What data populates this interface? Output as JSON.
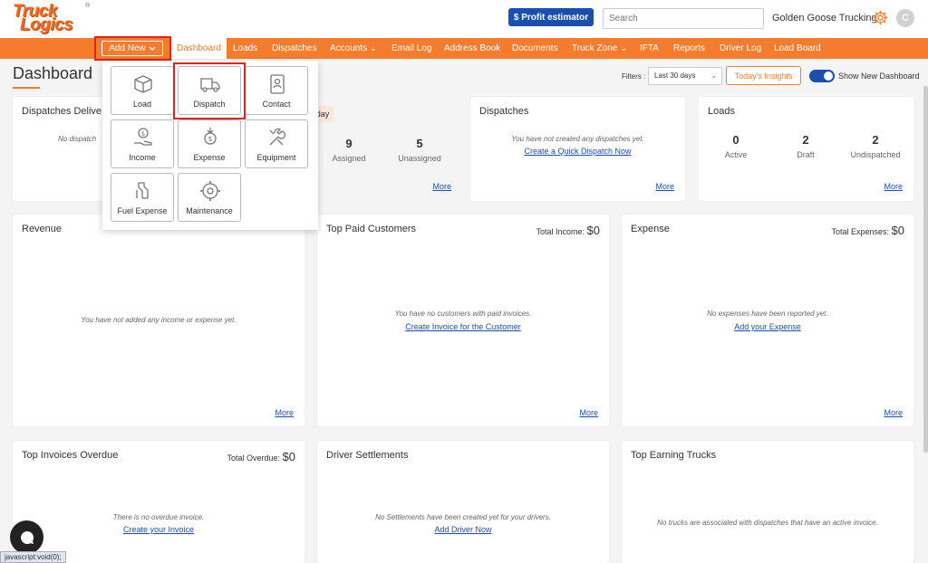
{
  "app": {
    "logo_line1": "Truck",
    "logo_line2": "Logics",
    "logo_reg": "®",
    "profit_estimator": "$ Profit estimator",
    "search_placeholder": "Search",
    "company": "Golden Goose Trucking",
    "avatar_initial": "C"
  },
  "nav": {
    "add_new": "Add New",
    "items": [
      "Dashboard",
      "Loads",
      "Dispatches",
      "Accounts ⌄",
      "Email Log",
      "Address Book",
      "Documents",
      "Truck Zone ⌄",
      "IFTA",
      "Reports",
      "Driver Log",
      "Load Board"
    ]
  },
  "header": {
    "title": "Dashboard",
    "filters_label": "Filters :",
    "filter_value": "Last 30 days",
    "insights": "Today's Insights",
    "toggle_label": "Show New Dashboard"
  },
  "add_menu": {
    "tiles": [
      "Load",
      "Dispatch",
      "Contact",
      "Income",
      "Expense",
      "Equipment",
      "Fuel Expense",
      "Maintenance"
    ]
  },
  "cards": {
    "dispatches_delivered": {
      "title": "Dispatches Delive",
      "empty": "No dispatch"
    },
    "day_tag": "day",
    "assigned": {
      "assigned_value": "9",
      "assigned_label": "Assigned",
      "unassigned_value": "5",
      "unassigned_label": "Unassigned",
      "more": "More"
    },
    "dispatches": {
      "title": "Dispatches",
      "empty": "You have not created any dispatches yet.",
      "link": "Create a Quick Dispatch Now",
      "more": "More"
    },
    "loads": {
      "title": "Loads",
      "active_value": "0",
      "active_label": "Active",
      "draft_value": "2",
      "draft_label": "Draft",
      "undisp_value": "2",
      "undisp_label": "Undispatched",
      "more": "More"
    },
    "revenue": {
      "title": "Revenue",
      "empty": "You have not added any income or expense yet.",
      "more": "More"
    },
    "top_paid": {
      "title": "Top Paid Customers",
      "total_label": "Total Income:",
      "total_value": "$0",
      "empty": "You have no customers with paid invoices.",
      "link": "Create Invoice for the Customer",
      "more": "More"
    },
    "expense": {
      "title": "Expense",
      "total_label": "Total Expenses:",
      "total_value": "$0",
      "empty": "No expenses have been reported yet.",
      "link": "Add your Expense",
      "more": "More"
    },
    "overdue": {
      "title": "Top Invoices Overdue",
      "total_label": "Total Overdue:",
      "total_value": "$0",
      "empty": "There is no overdue invoice.",
      "link": "Create your Invoice"
    },
    "settlements": {
      "title": "Driver Settlements",
      "empty": "No Settlements have been created yet for your drivers.",
      "link": "Add Driver Now"
    },
    "earning_trucks": {
      "title": "Top Earning Trucks",
      "empty": "No trucks are associated with dispatches that have an active invoice."
    }
  },
  "statusbar": "javascript:void(0);",
  "colors": {
    "brand_orange": "#f47c2c",
    "brand_blue": "#1a4fb0",
    "highlight_red": "#e2231a"
  }
}
